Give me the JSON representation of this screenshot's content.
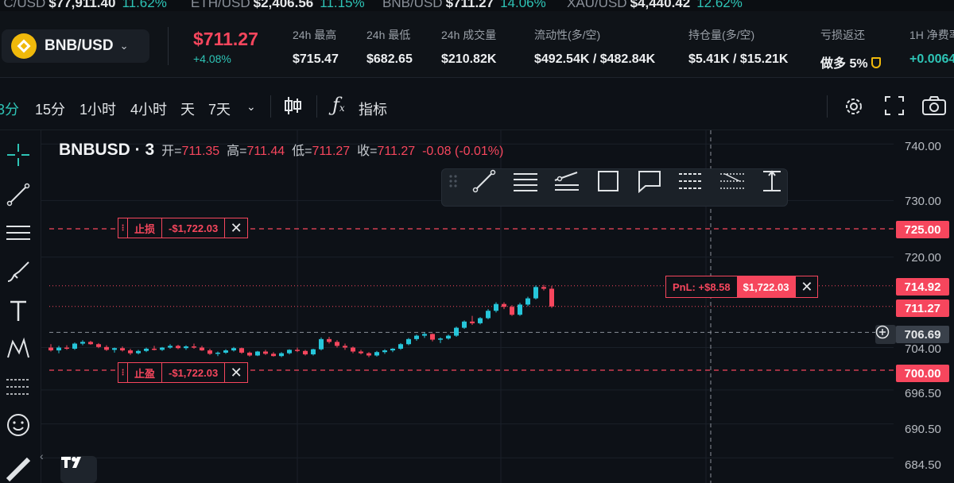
{
  "ticker": [
    {
      "symbol": "TC/USD",
      "price": "$77,911.40",
      "change": "11.62%"
    },
    {
      "symbol": "ETH/USD",
      "price": "$2,406.56",
      "change": "11.15%"
    },
    {
      "symbol": "BNB/USD",
      "price": "$711.27",
      "change": "14.06%"
    },
    {
      "symbol": "XAU/USD",
      "price": "$4,440.42",
      "change": "12.62%"
    }
  ],
  "header": {
    "pair": "BNB/USD",
    "last_price": "$711.27",
    "change_pct": "+4.08%",
    "stats": [
      {
        "label": "24h 最高",
        "value": "$715.47"
      },
      {
        "label": "24h 最低",
        "value": "$682.65"
      },
      {
        "label": "24h 成交量",
        "value": "$210.82K"
      },
      {
        "label": "流动性(多/空)",
        "value": "$492.54K / $482.84K"
      },
      {
        "label": "持仓量(多/空)",
        "value": "$5.41K / $15.21K"
      },
      {
        "label": "亏损返还",
        "value": "做多 5%"
      },
      {
        "label": "1H 净费率",
        "value": "+0.0064"
      }
    ]
  },
  "toolbar": {
    "timeframes": [
      "3分",
      "15分",
      "1小时",
      "4小时",
      "天",
      "7天"
    ],
    "active_timeframe": "3分",
    "indicators_label": "指标"
  },
  "legend": {
    "symbol": "BNBUSD · 3",
    "open_label": "开=",
    "open": "711.35",
    "high_label": "高=",
    "high": "711.44",
    "low_label": "低=",
    "low": "711.27",
    "close_label": "收=",
    "close": "711.27",
    "change": "-0.08 (-0.01%)"
  },
  "orders": {
    "stop_loss": {
      "label": "止损",
      "value": "-$1,722.03",
      "price": 725.0
    },
    "take_profit": {
      "label": "止盈",
      "value": "-$1,722.03",
      "price": 700.0
    },
    "position": {
      "pnl": "PnL: +$8.58",
      "amount": "$1,722.03",
      "price": 714.92
    }
  },
  "price_axis": {
    "labels": [
      "740.00",
      "730.00",
      "720.00",
      "704.00",
      "696.50",
      "690.50",
      "684.50"
    ],
    "pills": {
      "stop": "725.00",
      "entry": "714.92",
      "last": "711.27",
      "cross": "706.69",
      "tp": "700.00"
    }
  },
  "colors": {
    "up": "#26c6da",
    "down": "#f6465d",
    "accent": "#2ec4b6"
  },
  "chart_data": {
    "type": "candlestick",
    "title": "BNBUSD · 3",
    "y_range": [
      683,
      742
    ],
    "candles": [
      [
        704.0,
        704.6,
        703.3,
        703.5
      ],
      [
        703.5,
        704.3,
        703.0,
        704.0
      ],
      [
        704.0,
        704.4,
        703.6,
        703.8
      ],
      [
        703.8,
        704.9,
        703.6,
        704.7
      ],
      [
        704.7,
        705.3,
        704.4,
        705.0
      ],
      [
        705.0,
        705.2,
        704.5,
        704.6
      ],
      [
        704.6,
        704.8,
        703.9,
        704.1
      ],
      [
        704.1,
        704.4,
        703.4,
        703.6
      ],
      [
        703.6,
        704.0,
        703.1,
        703.9
      ],
      [
        703.9,
        704.2,
        703.3,
        703.5
      ],
      [
        703.5,
        703.8,
        702.7,
        703.0
      ],
      [
        703.0,
        703.6,
        702.8,
        703.4
      ],
      [
        703.4,
        704.0,
        703.2,
        703.8
      ],
      [
        703.8,
        704.3,
        703.5,
        703.6
      ],
      [
        703.6,
        704.1,
        703.4,
        704.0
      ],
      [
        704.0,
        704.6,
        703.8,
        704.3
      ],
      [
        704.3,
        704.5,
        703.7,
        703.9
      ],
      [
        703.9,
        704.4,
        703.6,
        704.2
      ],
      [
        704.2,
        704.7,
        703.8,
        704.0
      ],
      [
        704.0,
        704.3,
        703.4,
        703.5
      ],
      [
        703.5,
        703.8,
        702.7,
        702.9
      ],
      [
        702.9,
        703.3,
        702.5,
        703.1
      ],
      [
        703.1,
        703.7,
        702.9,
        703.5
      ],
      [
        703.5,
        704.1,
        703.3,
        703.9
      ],
      [
        703.9,
        704.0,
        702.9,
        703.1
      ],
      [
        703.1,
        703.3,
        702.4,
        702.6
      ],
      [
        702.6,
        703.4,
        702.5,
        703.3
      ],
      [
        703.3,
        703.6,
        702.7,
        702.9
      ],
      [
        702.9,
        703.2,
        702.4,
        702.5
      ],
      [
        702.5,
        703.2,
        702.3,
        703.0
      ],
      [
        703.0,
        703.7,
        702.8,
        703.6
      ],
      [
        703.6,
        704.0,
        703.2,
        703.4
      ],
      [
        703.4,
        703.6,
        702.6,
        702.8
      ],
      [
        702.8,
        703.8,
        702.6,
        703.7
      ],
      [
        703.7,
        705.8,
        703.5,
        705.5
      ],
      [
        705.5,
        705.9,
        704.7,
        705.0
      ],
      [
        705.0,
        705.3,
        704.0,
        704.3
      ],
      [
        704.3,
        704.7,
        703.6,
        704.0
      ],
      [
        704.0,
        704.2,
        703.0,
        703.3
      ],
      [
        703.3,
        703.6,
        702.8,
        703.0
      ],
      [
        703.0,
        703.2,
        702.3,
        702.6
      ],
      [
        702.6,
        703.4,
        702.4,
        703.2
      ],
      [
        703.2,
        703.7,
        702.9,
        703.5
      ],
      [
        703.5,
        703.9,
        703.2,
        703.8
      ],
      [
        703.8,
        704.8,
        703.6,
        704.6
      ],
      [
        704.6,
        705.7,
        704.4,
        705.5
      ],
      [
        705.5,
        706.3,
        705.2,
        706.1
      ],
      [
        706.1,
        706.7,
        705.7,
        706.4
      ],
      [
        706.4,
        706.5,
        705.1,
        705.4
      ],
      [
        705.4,
        705.8,
        704.8,
        705.6
      ],
      [
        705.6,
        706.3,
        705.4,
        706.1
      ],
      [
        706.1,
        707.7,
        705.9,
        707.5
      ],
      [
        707.5,
        708.8,
        707.3,
        708.6
      ],
      [
        708.6,
        709.6,
        708.0,
        708.3
      ],
      [
        708.3,
        709.4,
        708.1,
        709.2
      ],
      [
        709.2,
        710.8,
        709.0,
        710.5
      ],
      [
        710.5,
        712.0,
        710.2,
        711.7
      ],
      [
        711.7,
        712.0,
        710.8,
        711.2
      ],
      [
        711.2,
        711.5,
        709.6,
        709.8
      ],
      [
        709.8,
        711.9,
        709.6,
        711.6
      ],
      [
        711.6,
        713.0,
        711.3,
        712.7
      ],
      [
        712.7,
        715.0,
        712.5,
        714.7
      ],
      [
        714.7,
        715.1,
        714.1,
        714.4
      ],
      [
        714.4,
        714.9,
        711.0,
        711.27
      ]
    ]
  }
}
